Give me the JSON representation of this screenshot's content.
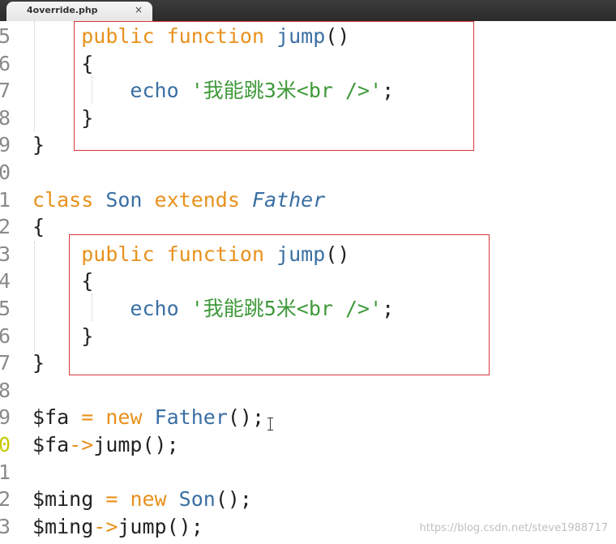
{
  "tab": {
    "title": "4override.php",
    "close": "×"
  },
  "lines": [
    {
      "n": "5",
      "tokens": [
        [
          "    ",
          "pl"
        ],
        [
          "public",
          "kw"
        ],
        [
          " ",
          "pl"
        ],
        [
          "function",
          "kw"
        ],
        [
          " ",
          "pl"
        ],
        [
          "jump",
          "fn"
        ],
        [
          "()",
          "pl"
        ]
      ]
    },
    {
      "n": "6",
      "tokens": [
        [
          "    {",
          "pl"
        ]
      ]
    },
    {
      "n": "7",
      "tokens": [
        [
          "        ",
          "pl"
        ],
        [
          "echo",
          "fn"
        ],
        [
          " ",
          "pl"
        ],
        [
          "'我能跳3米<br />'",
          "str"
        ],
        [
          ";",
          "pl"
        ]
      ]
    },
    {
      "n": "8",
      "tokens": [
        [
          "    }",
          "pl"
        ]
      ]
    },
    {
      "n": "9",
      "tokens": [
        [
          "}",
          "pl"
        ]
      ]
    },
    {
      "n": "0",
      "tokens": []
    },
    {
      "n": "1",
      "tokens": [
        [
          "class",
          "kw"
        ],
        [
          " ",
          "pl"
        ],
        [
          "Son",
          "cls"
        ],
        [
          " ",
          "pl"
        ],
        [
          "extends",
          "kw"
        ],
        [
          " ",
          "pl"
        ],
        [
          "Father",
          "it"
        ]
      ]
    },
    {
      "n": "2",
      "tokens": [
        [
          "{",
          "pl"
        ]
      ]
    },
    {
      "n": "3",
      "tokens": [
        [
          "    ",
          "pl"
        ],
        [
          "public",
          "kw"
        ],
        [
          " ",
          "pl"
        ],
        [
          "function",
          "kw"
        ],
        [
          " ",
          "pl"
        ],
        [
          "jump",
          "fn"
        ],
        [
          "()",
          "pl"
        ]
      ]
    },
    {
      "n": "4",
      "tokens": [
        [
          "    {",
          "pl"
        ]
      ]
    },
    {
      "n": "5",
      "tokens": [
        [
          "        ",
          "pl"
        ],
        [
          "echo",
          "fn"
        ],
        [
          " ",
          "pl"
        ],
        [
          "'我能跳5米<br />'",
          "str"
        ],
        [
          ";",
          "pl"
        ]
      ]
    },
    {
      "n": "6",
      "tokens": [
        [
          "    }",
          "pl"
        ]
      ]
    },
    {
      "n": "7",
      "tokens": [
        [
          "}",
          "pl"
        ]
      ]
    },
    {
      "n": "8",
      "tokens": []
    },
    {
      "n": "9",
      "tokens": [
        [
          "$fa",
          "var"
        ],
        [
          " ",
          "pl"
        ],
        [
          "=",
          "op"
        ],
        [
          " ",
          "pl"
        ],
        [
          "new",
          "kw"
        ],
        [
          " ",
          "pl"
        ],
        [
          "Father",
          "cls"
        ],
        [
          "();",
          "pl"
        ]
      ]
    },
    {
      "n": "0",
      "tokens": [
        [
          "$fa",
          "var"
        ],
        [
          "->",
          "op"
        ],
        [
          "jump",
          "pl"
        ],
        [
          "();",
          "pl"
        ]
      ],
      "active": true
    },
    {
      "n": "1",
      "tokens": []
    },
    {
      "n": "2",
      "tokens": [
        [
          "$ming",
          "var"
        ],
        [
          " ",
          "pl"
        ],
        [
          "=",
          "op"
        ],
        [
          " ",
          "pl"
        ],
        [
          "new",
          "kw"
        ],
        [
          " ",
          "pl"
        ],
        [
          "Son",
          "cls"
        ],
        [
          "();",
          "pl"
        ]
      ]
    },
    {
      "n": "3",
      "tokens": [
        [
          "$ming",
          "var"
        ],
        [
          "->",
          "op"
        ],
        [
          "jump",
          "pl"
        ],
        [
          "();",
          "pl"
        ]
      ]
    }
  ],
  "watermark": "https://blog.csdn.net/steve1988717",
  "colors": {
    "keyword": "#e8911c",
    "function": "#3a6fa3",
    "string": "#3f9a3a",
    "highlight_box": "#d9373a"
  }
}
